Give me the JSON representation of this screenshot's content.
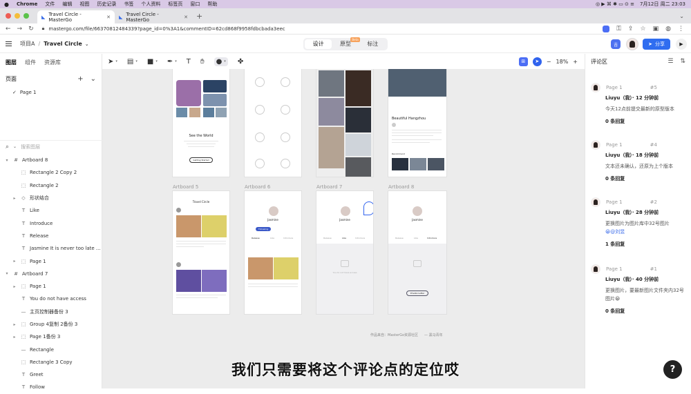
{
  "mac_menu": {
    "apple": "",
    "app": "Chrome",
    "items": [
      "文件",
      "编辑",
      "视图",
      "历史记录",
      "书签",
      "个人资料",
      "标签页",
      "窗口",
      "帮助"
    ],
    "datetime": "7月12日 周二 23:03"
  },
  "browser": {
    "tabs": [
      {
        "title": "Travel Circle - MasterGo"
      },
      {
        "title": "Travel Circle - MasterGo"
      }
    ],
    "new_tab": "+",
    "url": "mastergo.com/file/66370812484339?page_id=0%3A1&commentID=62cd868f9958fdbcbada3eec"
  },
  "app_header": {
    "project": "项目A",
    "separator": "/",
    "file_title": "Travel Circle",
    "modes": [
      "设计",
      "原型",
      "标注"
    ],
    "beta": "Beta",
    "user_badge": "吉",
    "share_label": "分享"
  },
  "left_panel": {
    "tabs": [
      "图层",
      "组件",
      "资源库"
    ],
    "pages_title": "页面",
    "pages": [
      {
        "name": "Page 1",
        "checked": true
      }
    ],
    "search_placeholder": "搜索图层",
    "layers": [
      {
        "name": "Artboard 8",
        "level": 0,
        "icon": "#",
        "twisty": "▾"
      },
      {
        "name": "Rectangle 2 Copy 2",
        "level": 1,
        "icon": "⬚",
        "twisty": ""
      },
      {
        "name": "Rectangle 2",
        "level": 1,
        "icon": "⬚",
        "twisty": ""
      },
      {
        "name": "形状结合",
        "level": 1,
        "icon": "◇",
        "twisty": "▸"
      },
      {
        "name": "Like",
        "level": 1,
        "icon": "T",
        "twisty": ""
      },
      {
        "name": "Introduce",
        "level": 1,
        "icon": "T",
        "twisty": ""
      },
      {
        "name": "Release",
        "level": 1,
        "icon": "T",
        "twisty": ""
      },
      {
        "name": "Jasmine It is never too late ...",
        "level": 1,
        "icon": "T",
        "twisty": ""
      },
      {
        "name": "Page 1",
        "level": 1,
        "icon": "⬚",
        "twisty": "▸"
      },
      {
        "name": "Artboard 7",
        "level": 0,
        "icon": "#",
        "twisty": "▾"
      },
      {
        "name": "Page 1",
        "level": 1,
        "icon": "⬚",
        "twisty": "▸"
      },
      {
        "name": "You do not have access",
        "level": 1,
        "icon": "T",
        "twisty": ""
      },
      {
        "name": "主页控制器备份 3",
        "level": 1,
        "icon": "—",
        "twisty": ""
      },
      {
        "name": "Group 4复制 2备份 3",
        "level": 1,
        "icon": "⬚",
        "twisty": "▸"
      },
      {
        "name": "Page 1备份 3",
        "level": 1,
        "icon": "⬚",
        "twisty": "▸"
      },
      {
        "name": "Rectangle",
        "level": 1,
        "icon": "—",
        "twisty": ""
      },
      {
        "name": "Rectangle 3 Copy",
        "level": 1,
        "icon": "⬚",
        "twisty": ""
      },
      {
        "name": "Greet",
        "level": 1,
        "icon": "T",
        "twisty": ""
      },
      {
        "name": "Follow",
        "level": 1,
        "icon": "T",
        "twisty": ""
      }
    ]
  },
  "toolbar": {
    "zoom": "18%",
    "minus": "−",
    "plus": "+"
  },
  "canvas": {
    "artboard_labels": [
      "Artboard 5",
      "Artboard 6",
      "Artboard 7",
      "Artboard 8"
    ],
    "see_world": "See the World",
    "getting_started": "Getting Started",
    "beautiful_hangzhou": "Beautiful Hangzhou",
    "recommend": "Recommend",
    "travel_circle": "Travel Circle",
    "jasmine": "Jasmine",
    "following": "Following",
    "release": "Release",
    "like": "Like",
    "introduce": "Introduce",
    "no_access": "You do not have access",
    "private_letter": "Private Letter",
    "credit_left": "作品来自：MasterGo资源社区",
    "credit_right": "—  黑马青年"
  },
  "subtitle": "我们只需要将这个评论点的定位哎",
  "comments_panel": {
    "title": "评论区",
    "comments": [
      {
        "page": "Page 1",
        "num": "#5",
        "author": "Liuyu（我）· 12 分钟前",
        "text": "今天12点前提交最新的原型版本",
        "mention": "",
        "replies": "0 条回复"
      },
      {
        "page": "Page 1",
        "num": "#4",
        "author": "Liuyu（我）· 18 分钟前",
        "text": "文本还未确认，还原为上个版本",
        "mention": "",
        "replies": "0 条回复"
      },
      {
        "page": "Page 1",
        "num": "#2",
        "author": "Liuyu（我）· 28 分钟前",
        "text": "更换图片为图片库中32号图片",
        "mention": "😀@刘昱",
        "replies": "1 条回复"
      },
      {
        "page": "Page 1",
        "num": "#1",
        "author": "Liuyu（我）· 40 分钟前",
        "text": "更换图片，要最新图片文件夹内32号图片😀",
        "mention": "",
        "replies": "0 条回复"
      }
    ]
  },
  "help_label": "?"
}
